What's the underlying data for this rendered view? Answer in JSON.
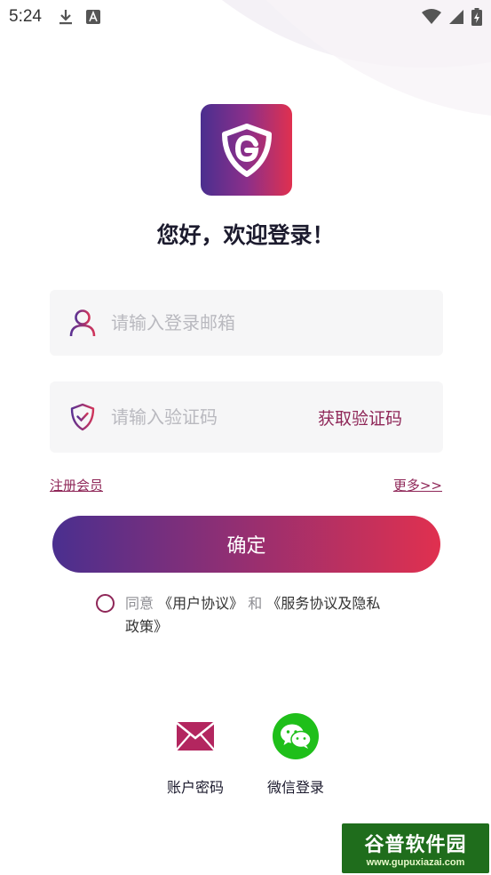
{
  "status_bar": {
    "time": "5:24"
  },
  "welcome": {
    "title": "您好，欢迎登录！"
  },
  "email_field": {
    "placeholder": "请输入登录邮箱",
    "value": ""
  },
  "code_field": {
    "placeholder": "请输入验证码",
    "value": "",
    "get_code_label": "获取验证码"
  },
  "links": {
    "register": "注册会员",
    "more": "更多>>"
  },
  "confirm": {
    "label": "确定"
  },
  "agreement": {
    "prefix": "同意",
    "user_agreement": "《用户协议》",
    "and": "和",
    "service_privacy": "《服务协议及隐私政策》"
  },
  "login_options": [
    {
      "label": "账户密码",
      "icon": "envelope-icon"
    },
    {
      "label": "微信登录",
      "icon": "wechat-icon"
    }
  ],
  "watermark": {
    "title": "谷普软件园",
    "url": "www.gupuxiazai.com"
  },
  "colors": {
    "accent": "#8f2758",
    "gradient_start": "#4a2f8f",
    "gradient_end": "#e0304f",
    "wechat_green": "#1fbf1a"
  }
}
